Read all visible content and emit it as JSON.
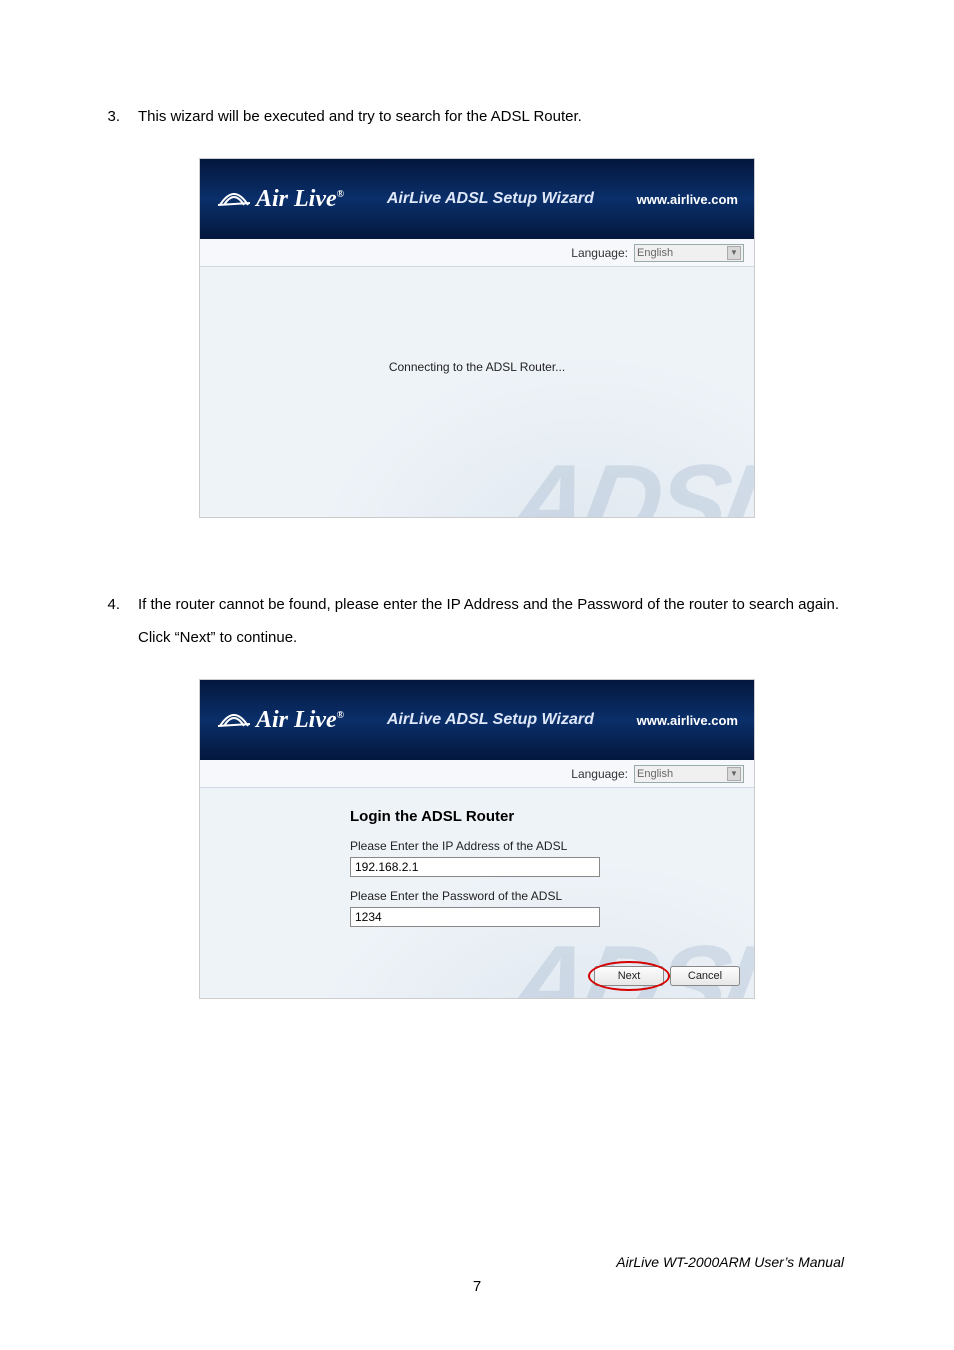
{
  "steps": {
    "s3": {
      "num": "3.",
      "text": "This wizard will be executed and try to search for the ADSL Router."
    },
    "s4": {
      "num": "4.",
      "text": "If the router cannot be found, please enter the IP Address and the Password of the router to search again. Click “Next” to continue."
    }
  },
  "wizard": {
    "brand": "Air Live",
    "title": "AirLive ADSL Setup Wizard",
    "url": "www.airlive.com",
    "lang_label": "Language:",
    "lang_value": "English",
    "watermark": "ADSL"
  },
  "panel1": {
    "status": "Connecting to the ADSL Router..."
  },
  "panel2": {
    "heading": "Login the ADSL Router",
    "ip_label": "Please Enter the IP Address of the ADSL",
    "ip_value": "192.168.2.1",
    "pw_label": "Please Enter the Password of the ADSL",
    "pw_value": "1234",
    "btn_next": "Next",
    "btn_cancel": "Cancel"
  },
  "footer": {
    "manual": "AirLive WT-2000ARM User’s Manual",
    "page": "7"
  }
}
